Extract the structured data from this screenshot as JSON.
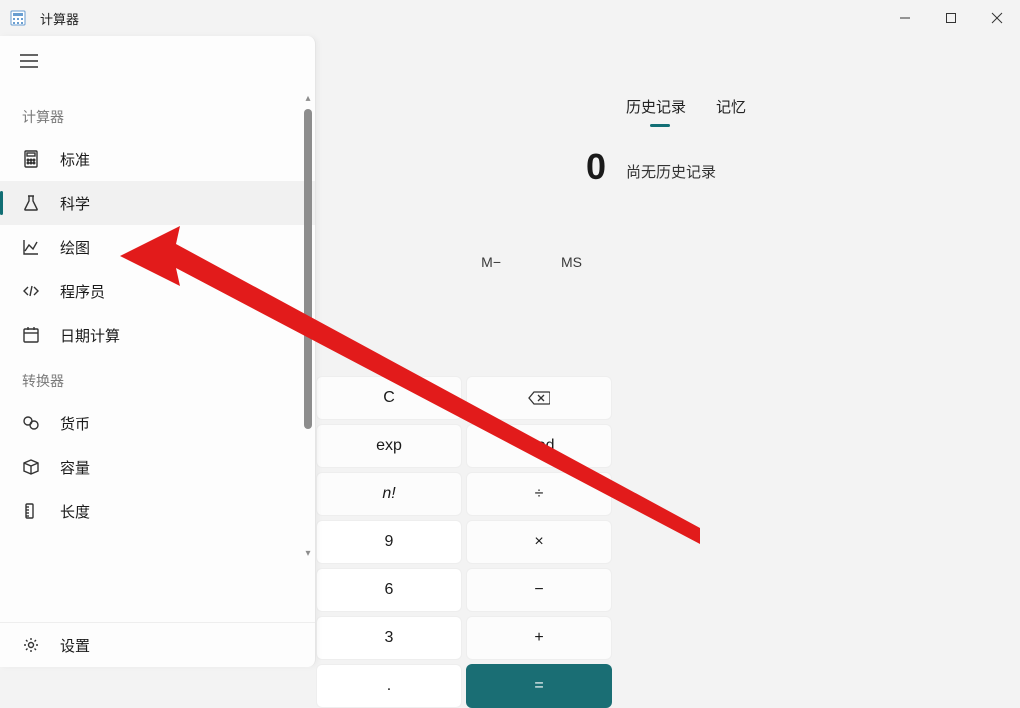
{
  "titlebar": {
    "title": "计算器"
  },
  "display": {
    "value": "0"
  },
  "memory": {
    "m_minus": "M−",
    "ms": "MS"
  },
  "tabs": {
    "history": "历史记录",
    "memory": "记忆"
  },
  "history_empty": "尚无历史记录",
  "keys": {
    "C": "C",
    "backspace_icon": "⌫",
    "exp": "exp",
    "mod": "mod",
    "fact": "n!",
    "div": "÷",
    "nine": "9",
    "mul": "×",
    "six": "6",
    "sub": "−",
    "three": "3",
    "add": "+",
    "dot": ".",
    "eq": "="
  },
  "nav": {
    "section_calc": "计算器",
    "section_conv": "转换器",
    "items": {
      "standard": "标准",
      "scientific": "科学",
      "graphing": "绘图",
      "programmer": "程序员",
      "date": "日期计算",
      "currency": "货币",
      "volume": "容量",
      "length": "长度",
      "settings": "设置"
    }
  }
}
